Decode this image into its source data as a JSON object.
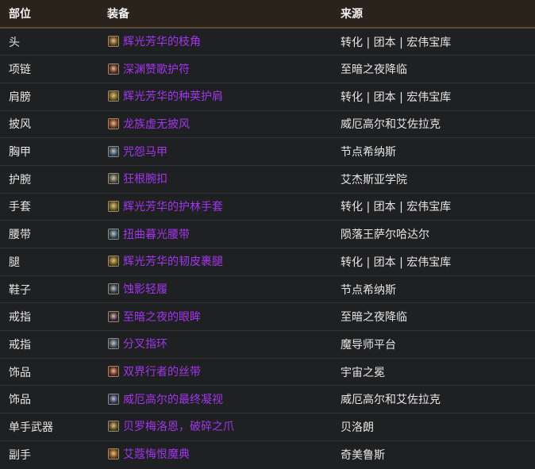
{
  "headers": {
    "slot": "部位",
    "item": "装备",
    "source": "来源"
  },
  "rows": [
    {
      "slot": "头",
      "item": "辉光芳华的枝角",
      "icon": "horned-helm-icon",
      "icon_color": "#6b4a22",
      "source": "转化 | 团本 | 宏伟宝库"
    },
    {
      "slot": "项链",
      "item": "深渊赞歌护符",
      "icon": "amulet-icon",
      "icon_color": "#5a3030",
      "source": "至暗之夜降临"
    },
    {
      "slot": "肩膀",
      "item": "辉光芳华的种荚护肩",
      "icon": "shoulder-icon",
      "icon_color": "#6f5a1e",
      "source": "转化 | 团本 | 宏伟宝库"
    },
    {
      "slot": "披风",
      "item": "龙族虚无披风",
      "icon": "cloak-icon",
      "icon_color": "#7a3b2a",
      "source": "威厄高尔和艾佐拉克"
    },
    {
      "slot": "胸甲",
      "item": "咒怨马甲",
      "icon": "vest-icon",
      "icon_color": "#2c4f7a",
      "source": "节点希纳斯"
    },
    {
      "slot": "护腕",
      "item": "狂根腕扣",
      "icon": "bracer-icon",
      "icon_color": "#4a4f55",
      "source": "艾杰斯亚学院"
    },
    {
      "slot": "手套",
      "item": "辉光芳华的护林手套",
      "icon": "gloves-icon",
      "icon_color": "#6b5a20",
      "source": "转化 | 团本 | 宏伟宝库"
    },
    {
      "slot": "腰带",
      "item": "扭曲暮光腰带",
      "icon": "belt-icon",
      "icon_color": "#2a4d78",
      "source": "陨落王萨尔哈达尔"
    },
    {
      "slot": "腿",
      "item": "辉光芳华的韧皮裹腿",
      "icon": "leggings-icon",
      "icon_color": "#6a5424",
      "source": "转化 | 团本 | 宏伟宝库"
    },
    {
      "slot": "鞋子",
      "item": "蚀影轻履",
      "icon": "boots-icon",
      "icon_color": "#2b3f5c",
      "source": "节点希纳斯"
    },
    {
      "slot": "戒指",
      "item": "至暗之夜的眼眸",
      "icon": "ring-icon",
      "icon_color": "#3d2a4a",
      "source": "至暗之夜降临"
    },
    {
      "slot": "戒指",
      "item": "分叉指环",
      "icon": "ring-icon",
      "icon_color": "#34507a",
      "source": "魔导师平台"
    },
    {
      "slot": "饰品",
      "item": "双界行者的丝带",
      "icon": "ribbon-icon",
      "icon_color": "#6a2a2a",
      "source": "宇宙之冕"
    },
    {
      "slot": "饰品",
      "item": "威厄高尔的最终凝视",
      "icon": "eye-icon",
      "icon_color": "#2a3a7a",
      "source": "威厄高尔和艾佐拉克"
    },
    {
      "slot": "单手武器",
      "item": "贝罗梅洛恩，破碎之爪",
      "icon": "claw-weapon-icon",
      "icon_color": "#5a4a2a",
      "source": "贝洛朗"
    },
    {
      "slot": "副手",
      "item": "艾蔻悔恨魔典",
      "icon": "tome-icon",
      "icon_color": "#7a4a1e",
      "source": "奇美鲁斯"
    }
  ],
  "colors": {
    "epic_item": "#a335ee",
    "header_bg": "#2a231b",
    "row_bg": "#1f2022"
  }
}
